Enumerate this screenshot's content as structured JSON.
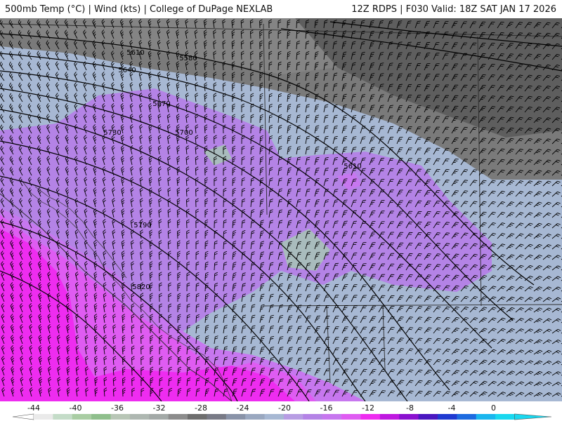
{
  "header": {
    "left_title": "500mb Temp (°C) | Wind (kts) | College of DuPage NEXLAB",
    "right_title": "12Z RDPS | F030 Valid: 18Z SAT JAN 17 2026"
  },
  "map": {
    "fill_colors": {
      "cold_gray": "#7a7a7a",
      "dark_gray": "#5e5e5e",
      "light_blue": "#a7b8d3",
      "lavender": "#b483e6",
      "violet": "#c777ef",
      "magenta": "#df5cf2",
      "hot_magenta": "#ee2cf0",
      "teal_gray": "#a9bcbd"
    },
    "height_labels": [
      "5610",
      "5580",
      "5640",
      "5670",
      "5700",
      "5730",
      "5610",
      "5790",
      "5820"
    ]
  },
  "colorbar": {
    "ticks": [
      "-44",
      "-40",
      "-36",
      "-32",
      "-28",
      "-24",
      "-20",
      "-16",
      "-12",
      "-8",
      "-4",
      "0"
    ],
    "colors": [
      "#eaeaea",
      "#c4dcc8",
      "#a9cda3",
      "#8fbf8c",
      "#b8c6b6",
      "#aeb7b1",
      "#a3a9a7",
      "#8c8c8c",
      "#6e6e6e",
      "#787a86",
      "#8993a8",
      "#9aa8c0",
      "#a7b8d3",
      "#b79de3",
      "#b483e6",
      "#c777ef",
      "#df5cf2",
      "#ee2cf0",
      "#bf18e0",
      "#8a10cf",
      "#4a17c0",
      "#1f3ad1",
      "#1d6be0",
      "#1ab6ee",
      "#19d8ef"
    ]
  }
}
